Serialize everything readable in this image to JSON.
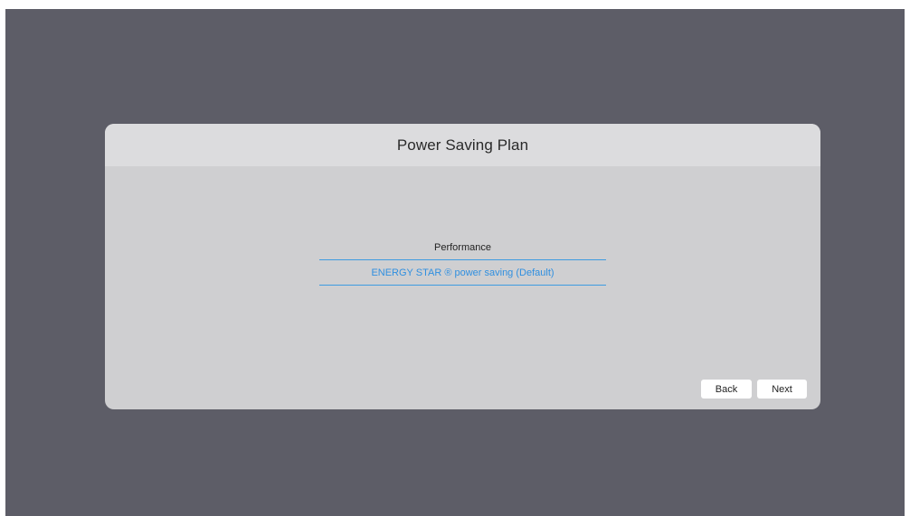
{
  "dialog": {
    "title": "Power Saving Plan",
    "options": [
      {
        "label": "Performance",
        "selected": false
      },
      {
        "label": "ENERGY STAR ® power saving (Default)",
        "selected": true
      }
    ],
    "back_label": "Back",
    "next_label": "Next"
  },
  "colors": {
    "background": "#5d5d67",
    "dialog_body": "#cfcfd1",
    "dialog_header": "#dcdcde",
    "accent": "#3d9be0"
  }
}
